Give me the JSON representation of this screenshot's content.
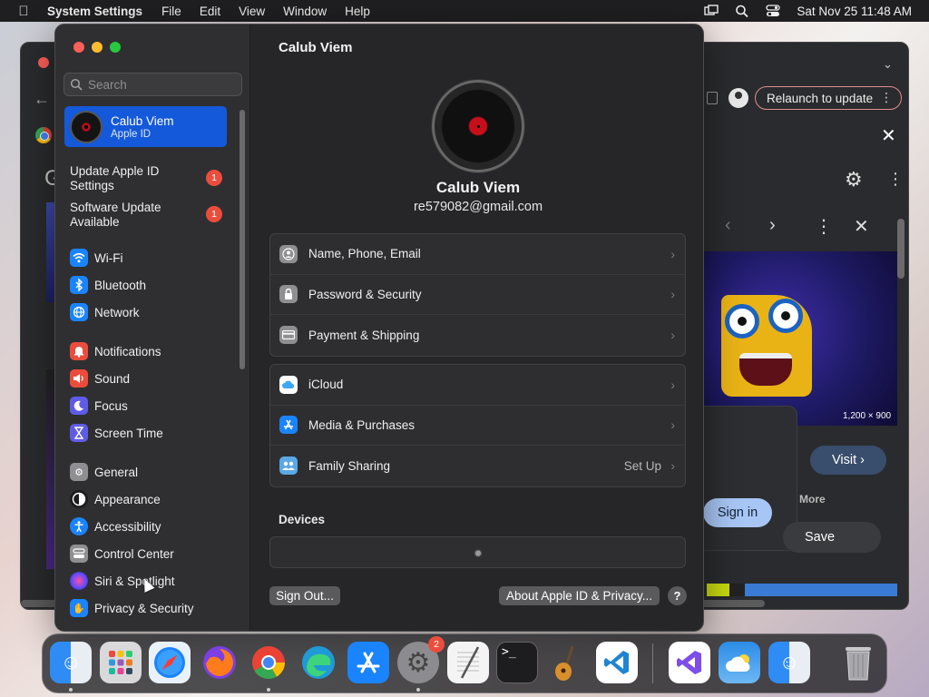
{
  "menubar": {
    "app_name": "System Settings",
    "menus": [
      "File",
      "Edit",
      "View",
      "Window",
      "Help"
    ],
    "datetime": "Sat Nov 25  11:48 AM"
  },
  "background_browser": {
    "relaunch_label": "Relaunch to update",
    "image_dimensions": "1,200 × 900",
    "visit_label": "Visit",
    "more_label": "More",
    "save_label": "Save",
    "sign_in_label": "Sign in"
  },
  "settings": {
    "search": {
      "placeholder": "Search",
      "value": ""
    },
    "apple_id": {
      "name": "Calub Viem",
      "subtitle": "Apple ID"
    },
    "alerts": [
      {
        "label": "Update Apple ID Settings",
        "count": "1"
      },
      {
        "label": "Software Update Available",
        "count": "1"
      }
    ],
    "sidebar_items": [
      {
        "label": "Wi-Fi",
        "icon": "wifi-icon",
        "color": "#1a84ff"
      },
      {
        "label": "Bluetooth",
        "icon": "bluetooth-icon",
        "color": "#1a84ff"
      },
      {
        "label": "Network",
        "icon": "globe-icon",
        "color": "#1a84ff"
      },
      {
        "label": "Notifications",
        "icon": "bell-icon",
        "color": "#eb4d3d"
      },
      {
        "label": "Sound",
        "icon": "speaker-icon",
        "color": "#eb4d3d"
      },
      {
        "label": "Focus",
        "icon": "moon-icon",
        "color": "#5e5ce6"
      },
      {
        "label": "Screen Time",
        "icon": "hourglass-icon",
        "color": "#5e5ce6"
      },
      {
        "label": "General",
        "icon": "gear-icon",
        "color": "#8e8e93"
      },
      {
        "label": "Appearance",
        "icon": "appearance-icon",
        "color": "#1c1c1e"
      },
      {
        "label": "Accessibility",
        "icon": "accessibility-icon",
        "color": "#1a84ff"
      },
      {
        "label": "Control Center",
        "icon": "control-center-icon",
        "color": "#8e8e93"
      },
      {
        "label": "Siri & Spotlight",
        "icon": "siri-icon",
        "color": "#7d4ee8"
      },
      {
        "label": "Privacy & Security",
        "icon": "hand-icon",
        "color": "#1a84ff"
      }
    ],
    "main": {
      "title": "Calub Viem",
      "profile_name": "Calub Viem",
      "profile_email": "re579082@gmail.com",
      "group1": [
        {
          "label": "Name, Phone, Email",
          "icon": "person-icon",
          "color": "#8e8e93"
        },
        {
          "label": "Password & Security",
          "icon": "lock-icon",
          "color": "#8e8e93"
        },
        {
          "label": "Payment & Shipping",
          "icon": "card-icon",
          "color": "#8e8e93"
        }
      ],
      "group2": [
        {
          "label": "iCloud",
          "icon": "cloud-icon",
          "color": "#ffffff"
        },
        {
          "label": "Media & Purchases",
          "icon": "app-store-icon",
          "color": "#1a84ff"
        },
        {
          "label": "Family Sharing",
          "icon": "family-icon",
          "color": "#5aa9e6",
          "extra": "Set Up"
        }
      ],
      "devices_title": "Devices",
      "sign_out_label": "Sign Out...",
      "about_label": "About Apple ID & Privacy...",
      "help_label": "?"
    }
  },
  "dock": {
    "apps": [
      {
        "name": "Finder",
        "icon": "finder-icon",
        "color": "#2f8cf5",
        "running": true
      },
      {
        "name": "Launchpad",
        "icon": "launchpad-icon",
        "color": "#d9d9dc",
        "running": false
      },
      {
        "name": "Safari",
        "icon": "safari-icon",
        "color": "#e9f2fb",
        "running": false
      },
      {
        "name": "Firefox",
        "icon": "firefox-icon",
        "color": "#ff7b1c",
        "running": false
      },
      {
        "name": "Chrome",
        "icon": "chrome-icon",
        "color": "#ffffff",
        "running": true
      },
      {
        "name": "Edge",
        "icon": "edge-icon",
        "color": "#1f9ad6",
        "running": false
      },
      {
        "name": "App Store",
        "icon": "app-store-icon",
        "color": "#1a84ff",
        "running": false
      },
      {
        "name": "System Settings",
        "icon": "gear-icon",
        "color": "#8c8c90",
        "running": true,
        "badge": "2"
      },
      {
        "name": "TextEdit",
        "icon": "textedit-icon",
        "color": "#f4f4f4",
        "running": false
      },
      {
        "name": "Terminal",
        "icon": "terminal-icon",
        "color": "#1d1d1f",
        "running": false
      },
      {
        "name": "GarageBand",
        "icon": "guitar-icon",
        "color": "#2a2a2c",
        "running": false
      },
      {
        "name": "VS Code",
        "icon": "vscode-icon",
        "color": "#ffffff",
        "running": false
      },
      {
        "name": "Visual Studio",
        "icon": "visual-studio-icon",
        "color": "#ffffff",
        "running": false
      },
      {
        "name": "Weather",
        "icon": "weather-icon",
        "color": "#2b8ce6",
        "running": false
      },
      {
        "name": "Finder",
        "icon": "finder-icon",
        "color": "#2f8cf5",
        "running": false
      },
      {
        "name": "Trash",
        "icon": "trash-icon",
        "color": "transparent",
        "running": false
      }
    ]
  }
}
